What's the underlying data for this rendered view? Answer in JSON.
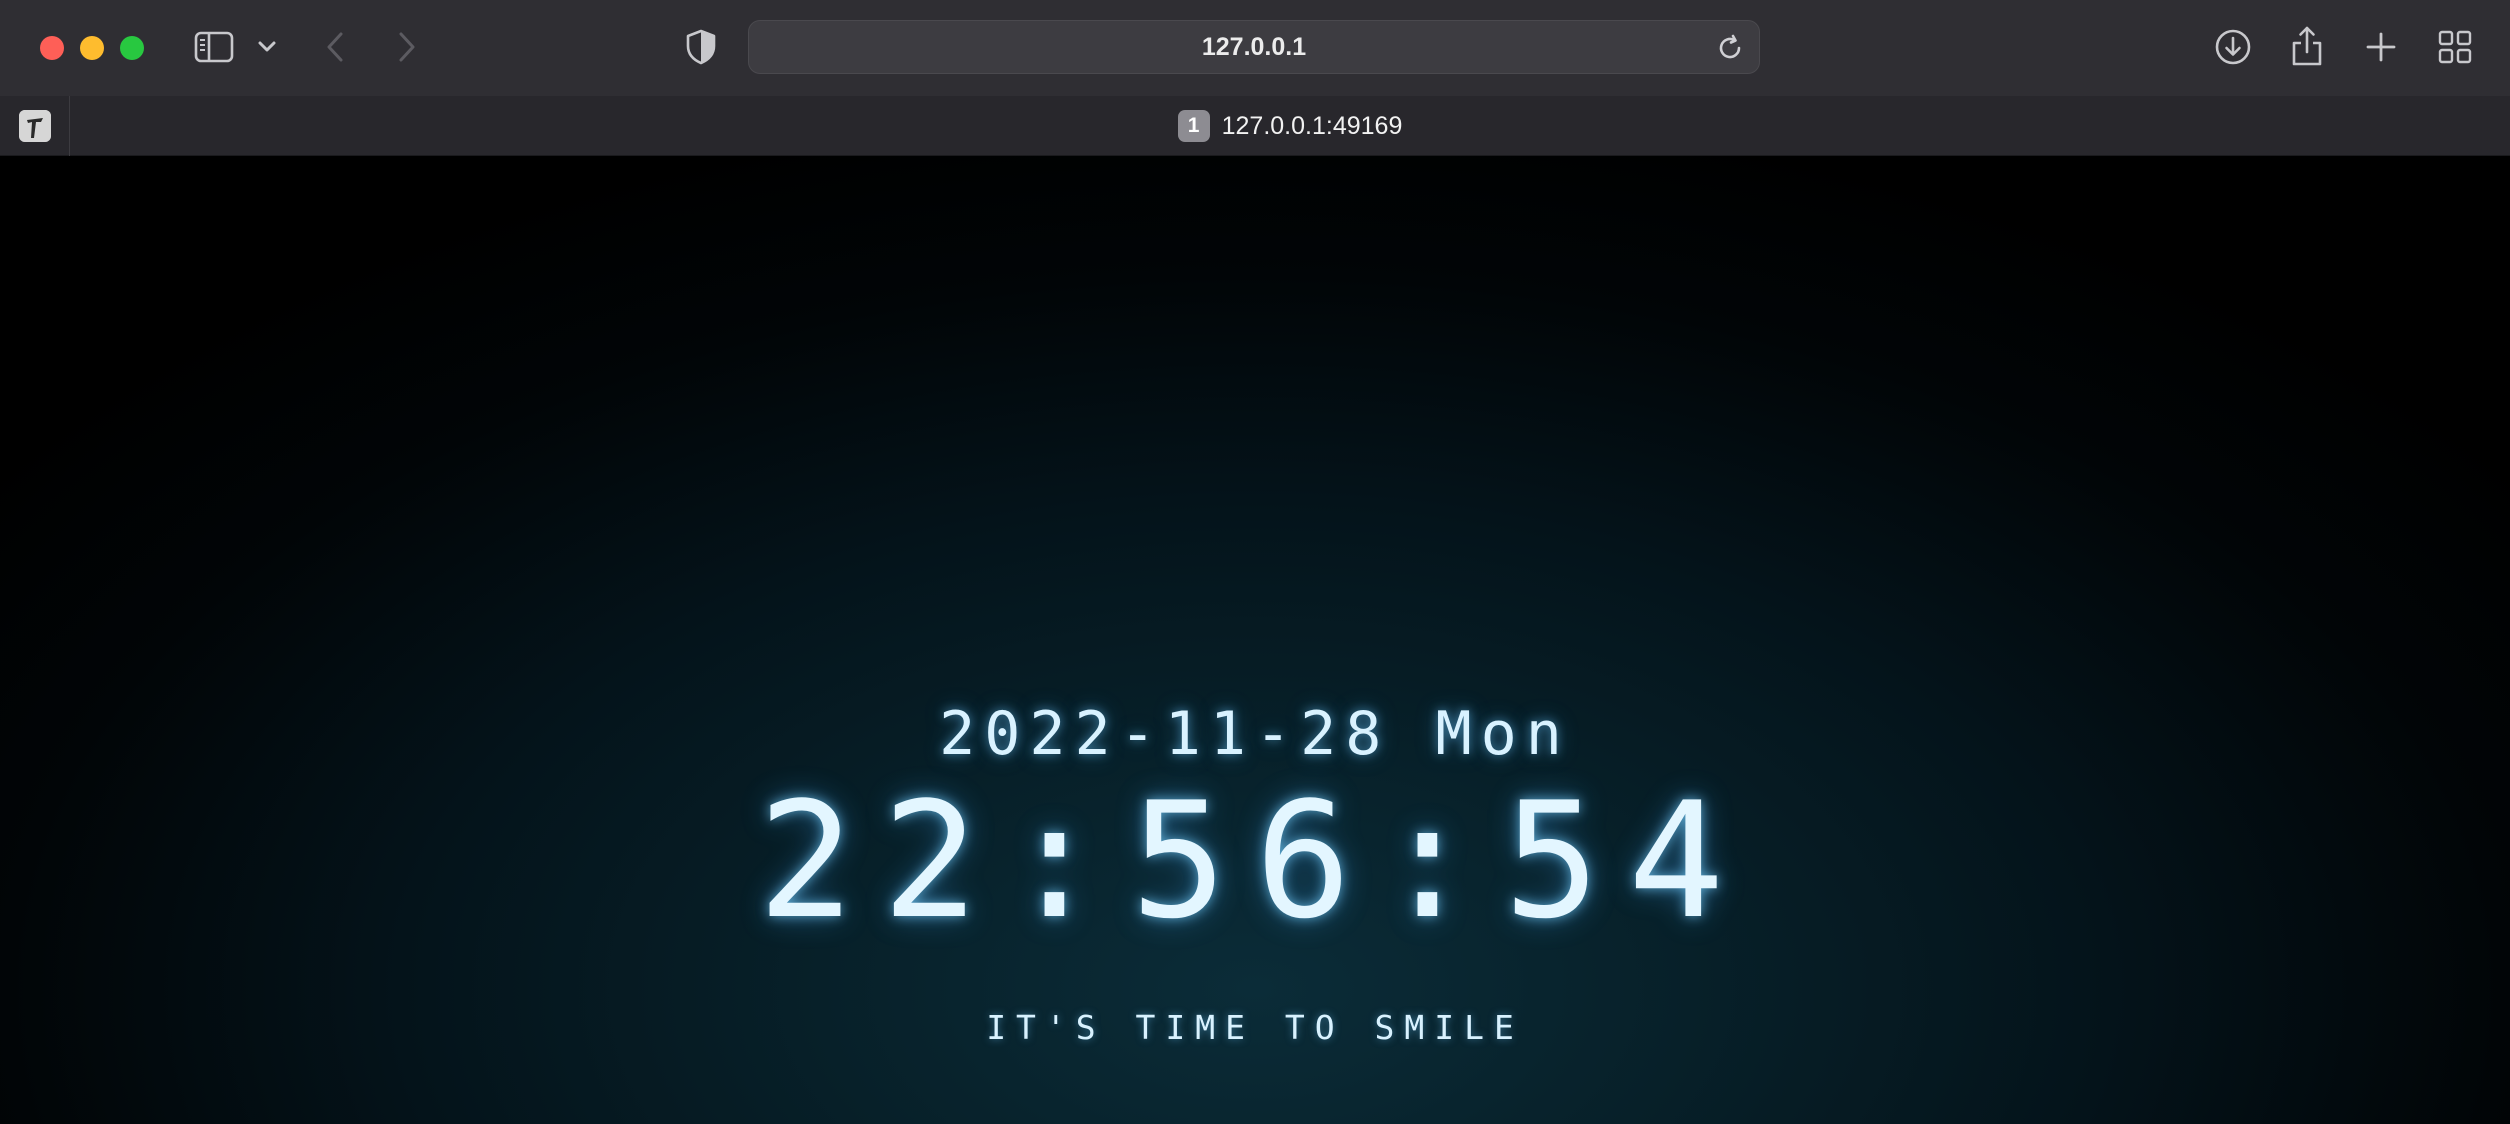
{
  "browser": {
    "address_bar": {
      "url": "127.0.0.1"
    },
    "tab": {
      "index_badge": "1",
      "title": "127.0.0.1:49169"
    },
    "icons": {
      "sidebar": "sidebar-icon",
      "sidebar_menu": "chevron-down-icon",
      "back": "back-arrow-icon",
      "forward": "forward-arrow-icon",
      "privacy": "shield-icon",
      "reload": "reload-icon",
      "downloads": "download-icon",
      "share": "share-icon",
      "new_tab": "plus-icon",
      "tab_overview": "tab-overview-icon"
    }
  },
  "clock": {
    "date": "2022-11-28 Mon",
    "time": "22:56:54",
    "tagline": "IT'S TIME TO SMILE"
  },
  "colors": {
    "toolbar": "#2f2e33",
    "tabstrip": "#28272c",
    "glow": "#7cd0ff",
    "text": "#e3f6ff"
  }
}
